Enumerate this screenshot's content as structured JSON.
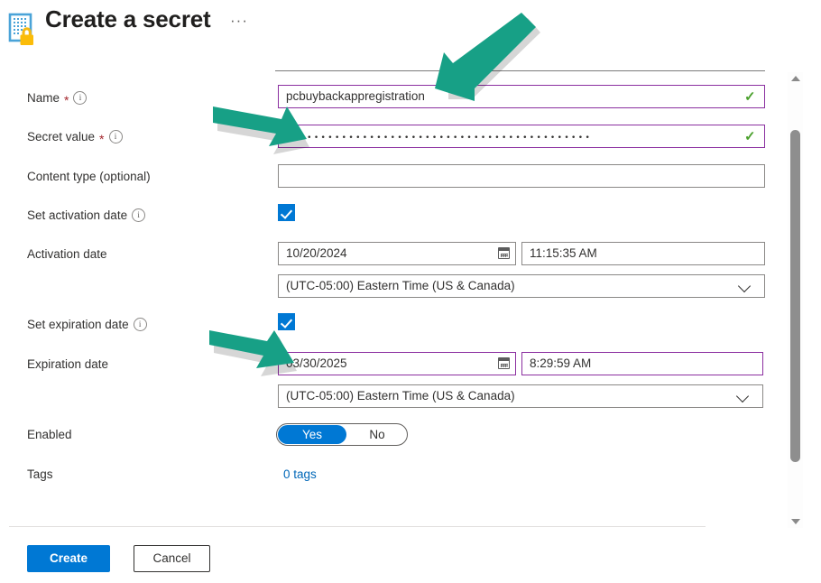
{
  "header": {
    "title": "Create a secret",
    "icon": "key-vault-secret-icon",
    "more_menu": "···"
  },
  "form": {
    "name": {
      "label": "Name",
      "required_marker": "*",
      "info": "i",
      "value": "pcbuybackappregistration",
      "validation": "✓"
    },
    "secret_value": {
      "label": "Secret value",
      "required_marker": "*",
      "info": "i",
      "value": "••••••••••••••••••••••••••••••••••••••••••••",
      "validation": "✓"
    },
    "content_type": {
      "label": "Content type (optional)",
      "value": "",
      "placeholder": ""
    },
    "set_activation_date": {
      "label": "Set activation date",
      "info": "i",
      "checked": "true"
    },
    "activation_date": {
      "label": "Activation date",
      "date": "10/20/2024",
      "time": "11:15:35 AM",
      "timezone": "(UTC-05:00) Eastern Time (US & Canada)"
    },
    "set_expiration_date": {
      "label": "Set expiration date",
      "info": "i",
      "checked": "true"
    },
    "expiration_date": {
      "label": "Expiration date",
      "date": "03/30/2025",
      "time": "8:29:59 AM",
      "timezone": "(UTC-05:00) Eastern Time (US & Canada)"
    },
    "enabled": {
      "label": "Enabled",
      "yes_label": "Yes",
      "no_label": "No",
      "selected": "Yes"
    },
    "tags": {
      "label": "Tags",
      "link_text": "0 tags"
    }
  },
  "footer": {
    "create_label": "Create",
    "cancel_label": "Cancel"
  },
  "colors": {
    "accent_blue": "#0078d4",
    "field_purple": "#8b2fa0",
    "valid_green": "#4aa02c",
    "required_red": "#a4262c",
    "annotation_teal": "#17a086",
    "link_blue": "#0067b8"
  },
  "annotations": [
    {
      "name": "arrow-to-name-field",
      "target": "name"
    },
    {
      "name": "arrow-to-secret-value-field",
      "target": "secret_value"
    },
    {
      "name": "arrow-to-expiration-date-field",
      "target": "expiration_date"
    }
  ]
}
